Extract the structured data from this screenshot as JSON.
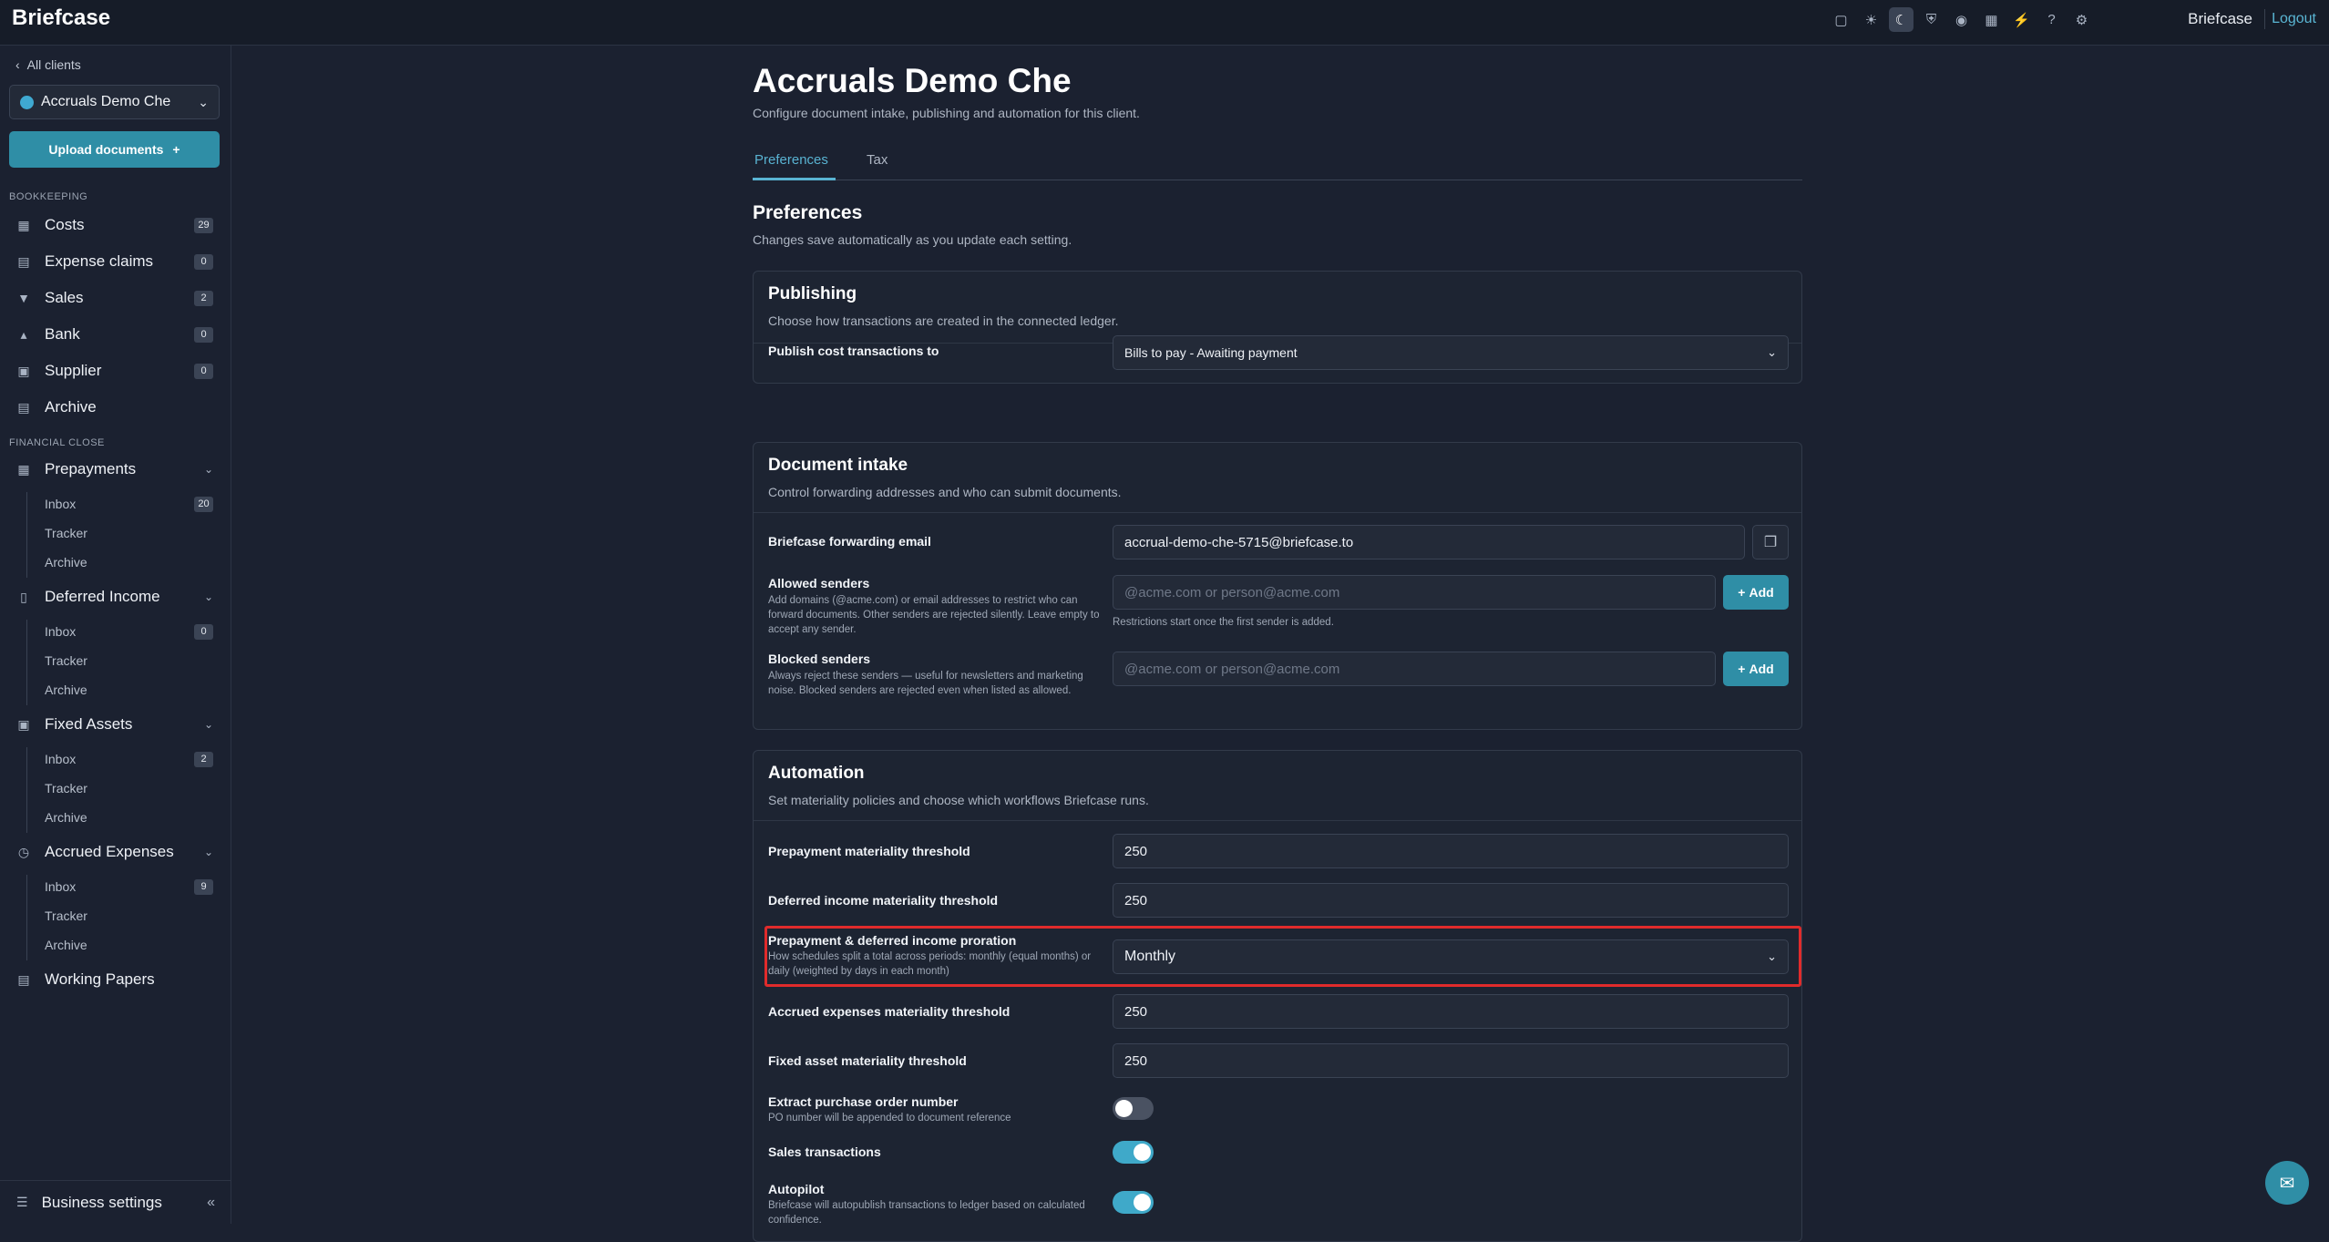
{
  "topbar": {
    "brand": "Briefcase",
    "icons": [
      "monitor-icon",
      "sun-icon",
      "moon-icon",
      "shield-icon",
      "circle-icon",
      "calculator-icon",
      "bolt-icon",
      "help-icon",
      "gear-icon"
    ],
    "brand_right": "Briefcase",
    "logout": "Logout"
  },
  "sidebar": {
    "back_label": "All clients",
    "client_name": "Accruals Demo Che",
    "upload_label": "Upload documents",
    "bookkeeping_header": "BOOKKEEPING",
    "bookkeeping": [
      {
        "label": "Costs",
        "count": "29"
      },
      {
        "label": "Expense claims",
        "count": "0"
      },
      {
        "label": "Sales",
        "count": "2"
      },
      {
        "label": "Bank",
        "count": "0"
      },
      {
        "label": "Supplier",
        "count": "0"
      },
      {
        "label": "Archive",
        "count": ""
      }
    ],
    "close_header": "FINANCIAL CLOSE",
    "close_groups": [
      {
        "label": "Prepayments",
        "inbox": "Inbox",
        "inbox_count": "20",
        "tracker": "Tracker",
        "archive": "Archive"
      },
      {
        "label": "Deferred Income",
        "inbox": "Inbox",
        "inbox_count": "0",
        "tracker": "Tracker",
        "archive": "Archive"
      },
      {
        "label": "Fixed Assets",
        "inbox": "Inbox",
        "inbox_count": "2",
        "tracker": "Tracker",
        "archive": "Archive"
      },
      {
        "label": "Accrued Expenses",
        "inbox": "Inbox",
        "inbox_count": "9",
        "tracker": "Tracker",
        "archive": "Archive"
      }
    ],
    "working_papers": "Working Papers",
    "business_settings": "Business settings"
  },
  "page": {
    "title": "Accruals Demo Che",
    "subtitle": "Configure document intake, publishing and automation for this client.",
    "tabs": [
      "Preferences",
      "Tax"
    ],
    "section_title": "Preferences",
    "section_sub": "Changes save automatically as you update each setting."
  },
  "publishing": {
    "title": "Publishing",
    "sub": "Choose how transactions are created in the connected ledger.",
    "publish_label": "Publish cost transactions to",
    "publish_value": "Bills to pay - Awaiting payment"
  },
  "intake": {
    "title": "Document intake",
    "sub": "Control forwarding addresses and who can submit documents.",
    "email_label": "Briefcase forwarding email",
    "email_value": "accrual-demo-che-5715@briefcase.to",
    "allowed_label": "Allowed senders",
    "allowed_help": "Add domains (@acme.com) or email addresses to restrict who can forward documents. Other senders are rejected silently. Leave empty to accept any sender.",
    "allowed_placeholder": "@acme.com or person@acme.com",
    "allowed_hint": "Restrictions start once the first sender is added.",
    "blocked_label": "Blocked senders",
    "blocked_help": "Always reject these senders — useful for newsletters and marketing noise. Blocked senders are rejected even when listed as allowed.",
    "blocked_placeholder": "@acme.com or person@acme.com",
    "add_label": "Add"
  },
  "automation": {
    "title": "Automation",
    "sub": "Set materiality policies and choose which workflows Briefcase runs.",
    "prepay_label": "Prepayment materiality threshold",
    "prepay_value": "250",
    "deferred_label": "Deferred income materiality threshold",
    "deferred_value": "250",
    "proration_label": "Prepayment & deferred income proration",
    "proration_help": "How schedules split a total across periods: monthly (equal months) or daily (weighted by days in each month)",
    "proration_value": "Monthly",
    "accrued_label": "Accrued expenses materiality threshold",
    "accrued_value": "250",
    "fixed_label": "Fixed asset materiality threshold",
    "fixed_value": "250",
    "po_label": "Extract purchase order number",
    "po_help": "PO number will be appended to document reference",
    "po_on": false,
    "sales_label": "Sales transactions",
    "sales_on": true,
    "autopilot_label": "Autopilot",
    "autopilot_help": "Briefcase will autopublish transactions to ledger based on calculated confidence.",
    "autopilot_on": true
  },
  "colors": {
    "accent": "#2f8ea6",
    "link": "#59b3d2",
    "highlight": "#e02b2b",
    "background": "#1b2130"
  }
}
